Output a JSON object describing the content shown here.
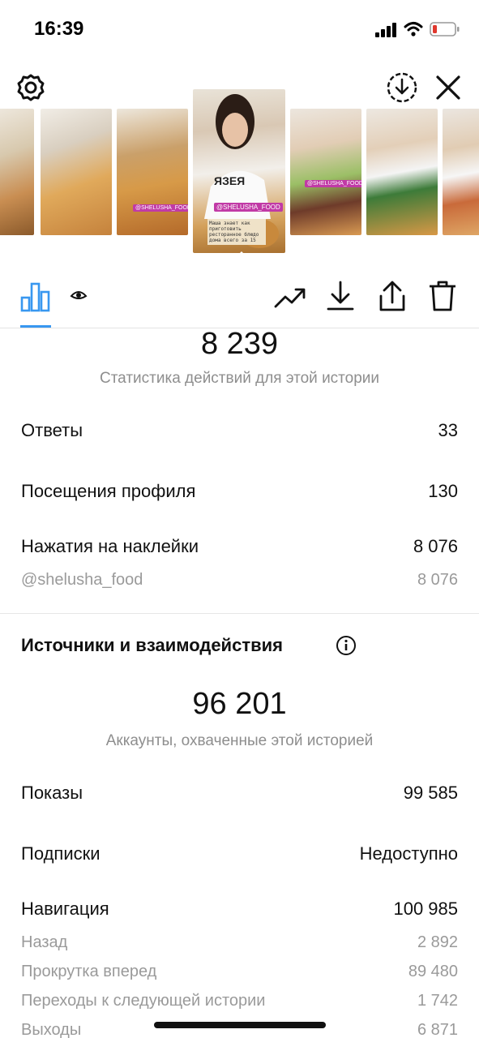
{
  "status_bar": {
    "time": "16:39"
  },
  "stories": {
    "selected_tag": "@SHELUSHA_FOOD",
    "selected_caption": "Маша знает как приготовить ресторанное блюдо дома всего за 15",
    "thumb_tags": [
      "@SHELUSHA_FOOD",
      "@SHELUSHA_FOOD"
    ]
  },
  "tabs": {
    "active": "chart-icon"
  },
  "actions": {
    "total": "8 239",
    "caption": "Статистика действий для этой истории",
    "rows": [
      {
        "label": "Ответы",
        "value": "33"
      },
      {
        "label": "Посещения профиля",
        "value": "130"
      },
      {
        "label": "Нажатия на наклейки",
        "value": "8 076"
      }
    ],
    "sticker_sub": {
      "label": "@shelusha_food",
      "value": "8 076"
    }
  },
  "discovery": {
    "title": "Источники и взаимодействия",
    "reach": "96 201",
    "reach_caption": "Аккаунты, охваченные этой историей",
    "rows": [
      {
        "label": "Показы",
        "value": "99 585"
      },
      {
        "label": "Подписки",
        "value": "Недоступно"
      },
      {
        "label": "Навигация",
        "value": "100 985"
      }
    ],
    "navigation_sub": [
      {
        "label": "Назад",
        "value": "2 892"
      },
      {
        "label": "Прокрутка вперед",
        "value": "89 480"
      },
      {
        "label": "Переходы к следующей истории",
        "value": "1 742"
      },
      {
        "label": "Выходы",
        "value": "6 871"
      }
    ]
  },
  "colors": {
    "accent": "#3897f0",
    "muted": "#8e8e8e"
  }
}
